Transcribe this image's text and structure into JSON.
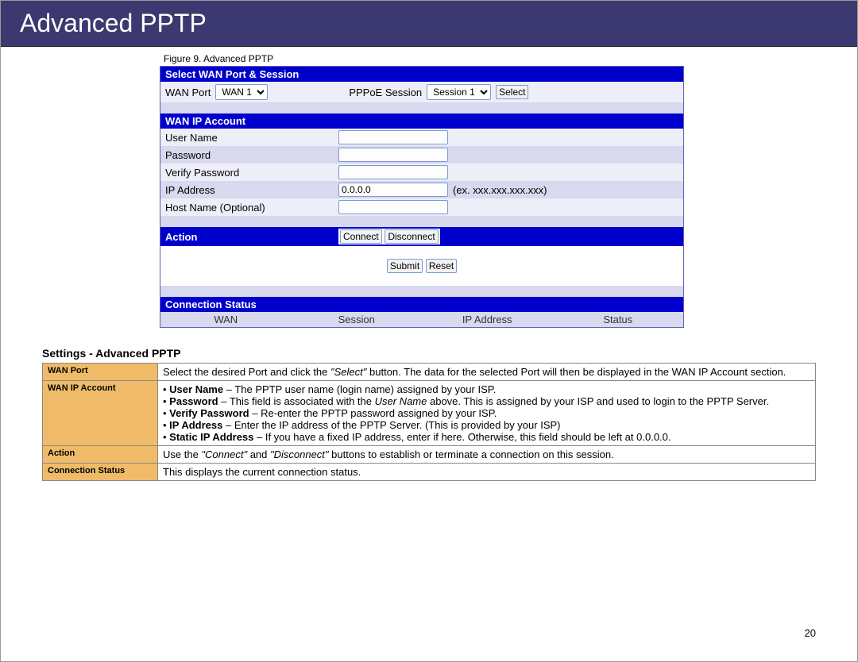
{
  "title": "Advanced PPTP",
  "figure_caption": "Figure 9.  Advanced PPTP",
  "router": {
    "select_header": "Select WAN Port & Session",
    "wan_port_label": "WAN Port",
    "wan_port_value": "WAN 1",
    "pppoe_label": "PPPoE Session",
    "pppoe_value": "Session 1",
    "select_btn": "Select",
    "wan_ip_header": "WAN IP Account",
    "user_name_label": "User Name",
    "password_label": "Password",
    "verify_pw_label": "Verify Password",
    "ip_addr_label": "IP Address",
    "ip_addr_value": "0.0.0.0",
    "ip_addr_hint": "(ex. xxx.xxx.xxx.xxx)",
    "host_name_label": "Host Name (Optional)",
    "action_label": "Action",
    "connect_btn": "Connect",
    "disconnect_btn": "Disconnect",
    "submit_btn": "Submit",
    "reset_btn": "Reset",
    "conn_status_header": "Connection Status",
    "cols": {
      "wan": "WAN",
      "session": "Session",
      "ip": "IP Address",
      "status": "Status"
    }
  },
  "settings_heading": "Settings - Advanced PPTP",
  "settings": {
    "wan_port_key": "WAN Port",
    "wan_port_desc_pre": "Select the desired Port and click the ",
    "wan_port_desc_italic": "\"Select\"",
    "wan_port_desc_post": " button. The data for the selected Port will then be displayed in the WAN IP Account section.",
    "wan_ip_key": "WAN IP Account",
    "b1_bold": "User Name",
    "b1_rest": " – The PPTP user name (login name) assigned by your ISP.",
    "b2_bold": "Password",
    "b2_mid": " – This field is associated with the ",
    "b2_italic": "User Name",
    "b2_rest": " above. This is assigned by your ISP and used to login to the PPTP Server.",
    "b3_bold": "Verify Password",
    "b3_rest": " – Re-enter the PPTP password assigned by your ISP.",
    "b4_bold": "IP Address",
    "b4_rest": " – Enter the IP address of the PPTP Server. (This is provided by your ISP)",
    "b5_bold": "Static IP Address",
    "b5_rest": " – If you have a fixed IP address, enter if here. Otherwise, this field should be left at 0.0.0.0.",
    "action_key": "Action",
    "action_desc_pre": "Use the ",
    "action_desc_i1": "\"Connect\"",
    "action_desc_mid": " and ",
    "action_desc_i2": "\"Disconnect\"",
    "action_desc_post": " buttons to establish or terminate a connection on this session.",
    "conn_key": "Connection Status",
    "conn_desc": "This displays the current connection status."
  },
  "page_number": "20"
}
